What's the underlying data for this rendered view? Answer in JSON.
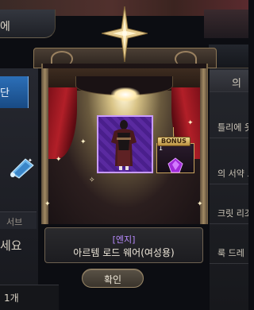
{
  "background": {
    "header_left_text": "에",
    "tab_active_text": "단",
    "sub_tab": "서브",
    "partial_text": "세요",
    "bottom_count": "1개",
    "right_items": [
      "의",
      "틀리에 옷",
      "의 서약 드",
      "크릿 리조",
      "룩 드레"
    ]
  },
  "popup": {
    "bonus_label": "BONUS",
    "bonus_count": "1",
    "grade": "[엔지]",
    "item_name": "아르템 로드 웨어(여성용)",
    "confirm_label": "확인"
  },
  "colors": {
    "grade": "#b98cff",
    "card_border": "#c89bff",
    "curtain": "#b21f28",
    "frame_gold": "#a28a63"
  },
  "icons": {
    "top_ornament": "compass-star-icon",
    "item": "outfit-figure-icon",
    "bonus_item": "purple-gem-icon",
    "left_item": "blue-scroll-icon"
  }
}
